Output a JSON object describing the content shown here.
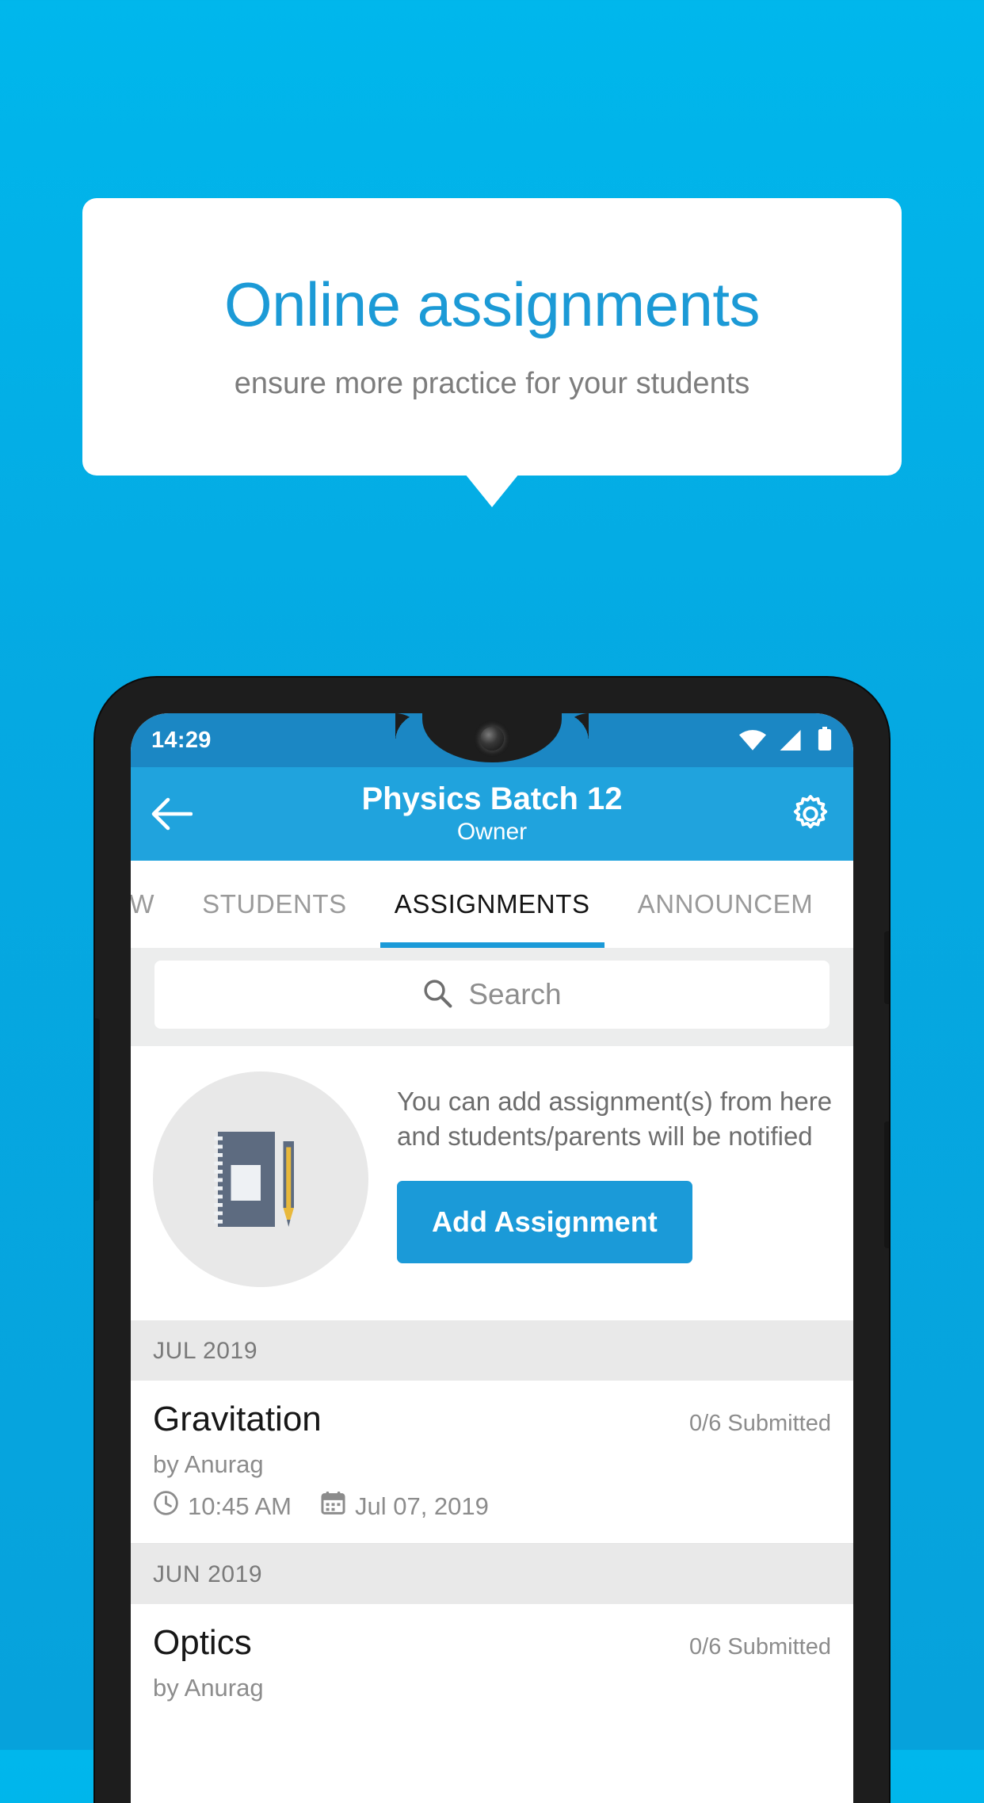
{
  "promo": {
    "title": "Online assignments",
    "subtitle": "ensure more practice for your students",
    "accent_color": "#1c9ad6",
    "background_color": "#00b3e8"
  },
  "status_bar": {
    "time": "14:29",
    "icons": [
      "wifi-icon",
      "signal-icon",
      "battery-icon"
    ]
  },
  "app_bar": {
    "back_icon": "back-arrow-icon",
    "title": "Physics Batch 12",
    "subtitle": "Owner",
    "settings_icon": "gear-icon",
    "color": "#20a3dd"
  },
  "tabs": [
    {
      "label": "IEW",
      "active": false
    },
    {
      "label": "STUDENTS",
      "active": false
    },
    {
      "label": "ASSIGNMENTS",
      "active": true
    },
    {
      "label": "ANNOUNCEM",
      "active": false
    }
  ],
  "search": {
    "placeholder": "Search",
    "value": "",
    "icon": "search-icon"
  },
  "empty_state": {
    "illustration": "notebook-and-pen-icon",
    "message": "You can add assignment(s) from here and students/parents will be notified",
    "button_label": "Add Assignment",
    "button_color": "#1b9ad8"
  },
  "sections": [
    {
      "month": "JUL 2019",
      "items": [
        {
          "title": "Gravitation",
          "submitted": "0/6 Submitted",
          "author": "by Anurag",
          "time": "10:45 AM",
          "date": "Jul 07, 2019",
          "time_icon": "clock-icon",
          "date_icon": "calendar-icon"
        }
      ]
    },
    {
      "month": "JUN 2019",
      "items": [
        {
          "title": "Optics",
          "submitted": "0/6 Submitted",
          "author": "by Anurag",
          "time": "",
          "date": "",
          "time_icon": "clock-icon",
          "date_icon": "calendar-icon"
        }
      ]
    }
  ]
}
